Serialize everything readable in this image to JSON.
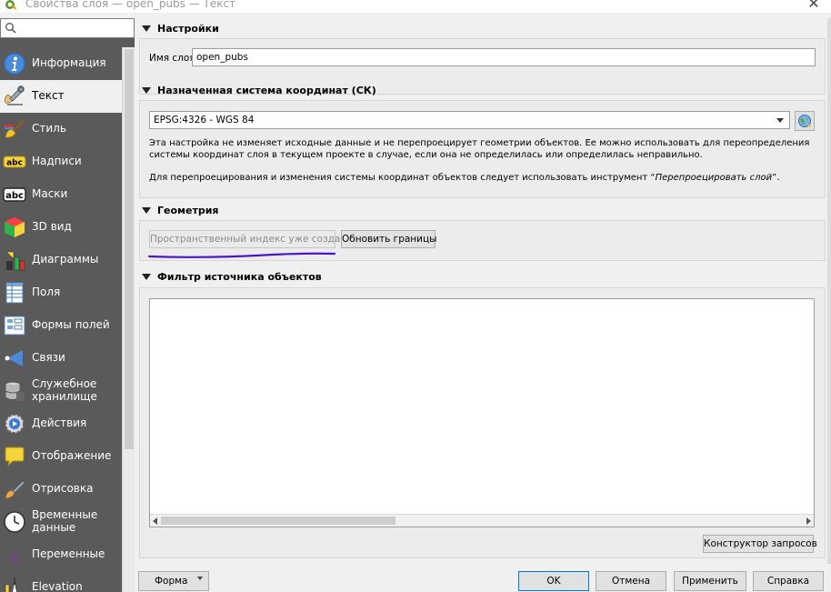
{
  "window": {
    "title": "Свойства слоя — open_pubs — Текст",
    "close_glyph": "✕"
  },
  "sidebar": {
    "search_placeholder": "",
    "items": [
      {
        "label": "Информация",
        "icon": "info-icon",
        "active": false
      },
      {
        "label": "Текст",
        "icon": "source-wrench-icon",
        "active": true
      },
      {
        "label": "Стиль",
        "icon": "style-brush-icon",
        "active": false
      },
      {
        "label": "Надписи",
        "icon": "labels-abc-icon",
        "active": false
      },
      {
        "label": "Маски",
        "icon": "masks-abc-icon",
        "active": false
      },
      {
        "label": "3D вид",
        "icon": "cube-3d-icon",
        "active": false
      },
      {
        "label": "Диаграммы",
        "icon": "diagrams-icon",
        "active": false
      },
      {
        "label": "Поля",
        "icon": "fields-icon",
        "active": false
      },
      {
        "label": "Формы полей",
        "icon": "attributes-form-icon",
        "active": false
      },
      {
        "label": "Связи",
        "icon": "joins-icon",
        "active": false
      },
      {
        "label_line1": "Служебное",
        "label_line2": "хранилище",
        "icon": "auxiliary-storage-icon",
        "active": false
      },
      {
        "label": "Действия",
        "icon": "actions-icon",
        "active": false
      },
      {
        "label": "Отображение",
        "icon": "display-icon",
        "active": false
      },
      {
        "label": "Отрисовка",
        "icon": "rendering-brush-icon",
        "active": false
      },
      {
        "label_line1": "Временные",
        "label_line2": "данные",
        "icon": "temporal-clock-icon",
        "active": false
      },
      {
        "label": "Переменные",
        "icon": "variables-icon",
        "active": false
      },
      {
        "label": "Elevation",
        "icon": "elevation-icon",
        "active": false
      }
    ]
  },
  "settings": {
    "title": "Настройки",
    "layer_name_label": "Имя слоя",
    "layer_name_value": "open_pubs"
  },
  "crs": {
    "title": "Назначенная система координат (СК)",
    "selected": "EPSG:4326 - WGS 84",
    "desc_line1": "Эта настройка не изменяет исходные данные и не перепроецирует геометрии объектов. Ее можно использовать для переопределения",
    "desc_line2": "системы координат слоя в текущем проекте в случае, если она не определилась или определилась неправильно.",
    "desc_line3_prefix": "Для перепроецирования и изменения системы координат объектов следует использовать инструмент “",
    "desc_line3_tool": "Перепроецировать слой",
    "desc_line3_suffix": "”."
  },
  "geometry": {
    "title": "Геометрия",
    "spatial_index_label": "Пространственный индекс уже создан",
    "update_extents_label": "Обновить границы",
    "underline_color": "#4b18c8"
  },
  "filter": {
    "title": "Фильтр источника объектов",
    "query_builder_label": "Конструктор запросов"
  },
  "bottom": {
    "style_label": "Форма",
    "ok_label": "OK",
    "cancel_label": "Отмена",
    "apply_label": "Применить",
    "help_label": "Справка"
  }
}
